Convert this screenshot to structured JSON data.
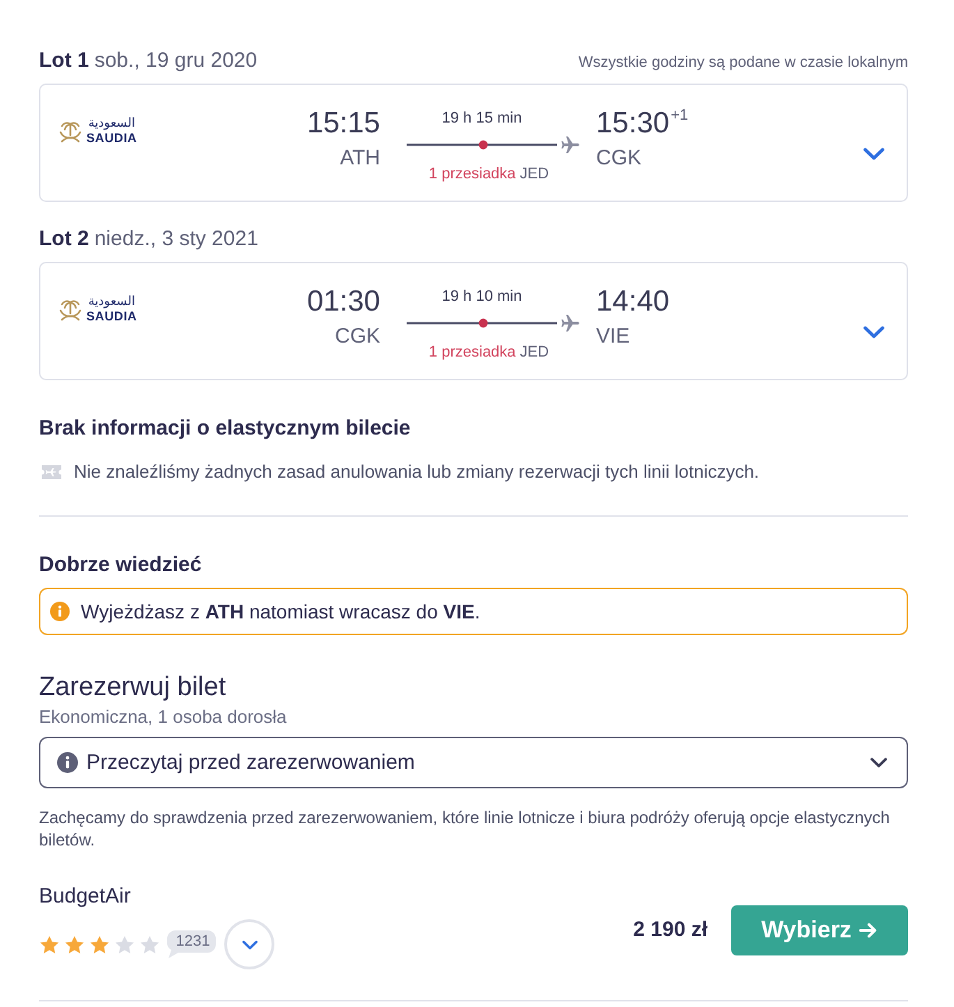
{
  "flights": [
    {
      "label": "Lot 1",
      "date": "sob., 19 gru 2020",
      "note": "Wszystkie godziny są podane w czasie lokalnym",
      "airline": {
        "arabic": "السعودية",
        "latin": "SAUDIA"
      },
      "departure": {
        "time": "15:15",
        "airport": "ATH"
      },
      "duration": "19 h 15 min",
      "stops": "1 przesiadka",
      "stop_airport": "JED",
      "arrival": {
        "time": "15:30",
        "day_offset": "+1",
        "airport": "CGK"
      },
      "expanded": false
    },
    {
      "label": "Lot 2",
      "date": "niedz., 3 sty 2021",
      "airline": {
        "arabic": "السعودية",
        "latin": "SAUDIA"
      },
      "departure": {
        "time": "01:30",
        "airport": "CGK"
      },
      "duration": "19 h 10 min",
      "stops": "1 przesiadka",
      "stop_airport": "JED",
      "arrival": {
        "time": "14:40",
        "airport": "VIE"
      },
      "expanded": false
    }
  ],
  "flexible_ticket": {
    "title": "Brak informacji o elastycznym bilecie",
    "text": "Nie znaleźliśmy żadnych zasad anulowania lub zmiany rezerwacji tych linii lotniczych."
  },
  "good_to_know": {
    "title": "Dobrze wiedzieć",
    "message": "Wyjeżdżasz z **ATH** natomiast wracasz do **VIE**."
  },
  "booking": {
    "title": "Zarezerwuj bilet",
    "subtitle": "Ekonomiczna, 1 osoba dorosła",
    "dropdown": {
      "label": "Przeczytaj przed zarezerwowaniem",
      "expanded": false
    },
    "note": "Zachęcamy do sprawdzenia przed zarezerwowaniem, które linie lotnicze i biura podróży oferują opcje elastycznych biletów."
  },
  "offers": [
    {
      "provider": "BudgetAir",
      "stars": 3,
      "reviews": "1231",
      "price": "2 190 zł",
      "button": "Wybierz"
    }
  ]
}
